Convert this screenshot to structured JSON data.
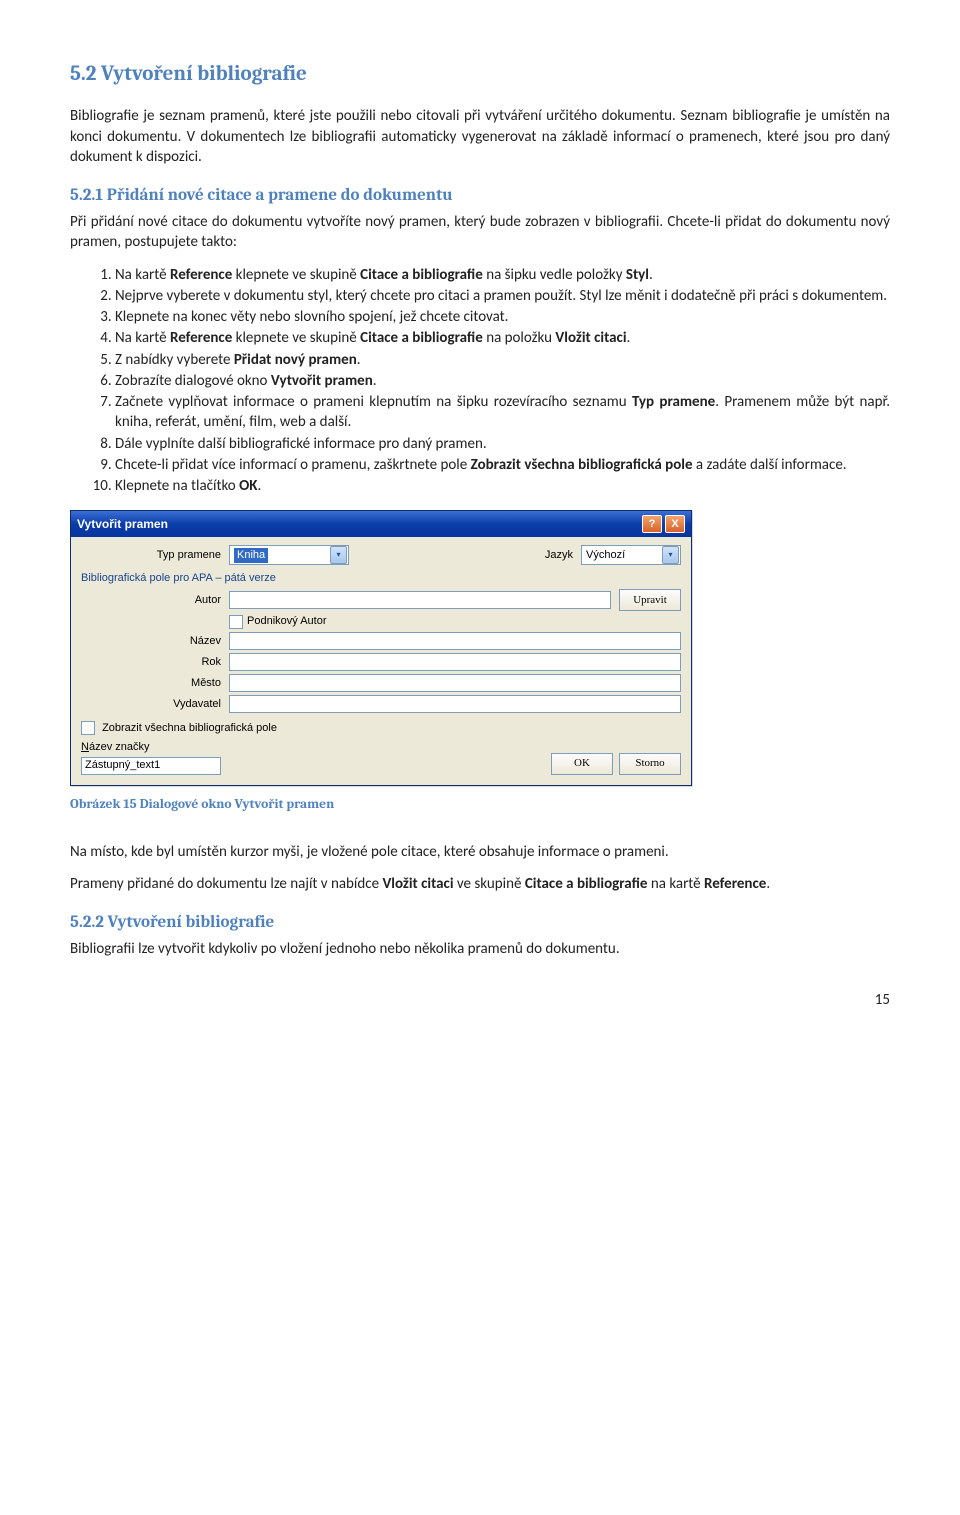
{
  "doc": {
    "h2": "5.2   Vytvoření bibliografie",
    "p1": "Bibliografie je seznam pramenů, které jste použili nebo citovali při vytváření určitého dokumentu. Seznam bibliografie je umístěn na konci dokumentu. V dokumentech lze bibliografii automaticky vygenerovat na základě informací o pramenech, které jsou pro daný dokument k dispozici.",
    "h3a": "5.2.1   Přidání nové citace a pramene do dokumentu",
    "p2": "Při přidání nové citace do dokumentu vytvoříte nový pramen, který bude zobrazen v bibliografii. Chcete-li přidat do dokumentu nový pramen, postupujete takto:",
    "ol": [
      {
        "pre": "Na kartě ",
        "b1": "Reference",
        "mid1": " klepnete ve skupině ",
        "b2": "Citace a bibliografie",
        "mid2": " na šipku vedle položky ",
        "b3": "Styl",
        "post": "."
      },
      {
        "text": "Nejprve vyberete v dokumentu styl, který chcete pro citaci a pramen použít. Styl lze měnit i dodatečně při práci s dokumentem."
      },
      {
        "text": "Klepnete na konec věty nebo slovního spojení, jež chcete citovat."
      },
      {
        "pre": "Na kartě ",
        "b1": "Reference",
        "mid1": " klepnete ve skupině ",
        "b2": "Citace a bibliografie",
        "mid2": " na položku ",
        "b3": "Vložit citaci",
        "post": "."
      },
      {
        "pre": "Z nabídky vyberete ",
        "b1": "Přidat nový pramen",
        "post": "."
      },
      {
        "pre": "Zobrazíte dialogové okno ",
        "b1": "Vytvořit pramen",
        "post": "."
      },
      {
        "pre": "Začnete vyplňovat informace o prameni klepnutím na šipku rozevíracího seznamu ",
        "b1": "Typ pramene",
        "post": ". Pramenem může být např. kniha, referát, umění, film, web a další."
      },
      {
        "text": "Dále vyplníte další bibliografické informace pro daný pramen."
      },
      {
        "pre": "Chcete-li přidat více informací o pramenu, zaškrtnete pole ",
        "b1": "Zobrazit všechna bibliografická pole",
        "post": " a zadáte další informace."
      },
      {
        "pre": "Klepnete na tlačítko ",
        "b1": "OK",
        "post": "."
      }
    ],
    "caption": "Obrázek 15 Dialogové okno Vytvořit pramen",
    "p3": "Na místo, kde byl umístěn kurzor myši, je vložené pole citace, které obsahuje informace o prameni.",
    "p4_pre": "Prameny přidané do dokumentu lze najít v nabídce ",
    "p4_b1": "Vložit citaci",
    "p4_mid": " ve skupině ",
    "p4_b2": "Citace a bibliografie",
    "p4_mid2": " na kartě ",
    "p4_b3": "Reference",
    "p4_post": ".",
    "h3b": "5.2.2   Vytvoření bibliografie",
    "p5": "Bibliografii lze vytvořit kdykoliv po vložení jednoho nebo několika pramenů do dokumentu.",
    "pagenum": "15"
  },
  "dlg": {
    "title": "Vytvořit pramen",
    "help": "?",
    "close": "X",
    "typ_label": "Typ pramene",
    "typ_value": "Kniha",
    "jazyk_label": "Jazyk",
    "jazyk_value": "Výchozí",
    "subhead": "Bibliografická pole pro APA – pátá verze",
    "autor_label": "Autor",
    "upravit": "Upravit",
    "pod_autor": "Podnikový Autor",
    "nazev_label": "Název",
    "rok_label": "Rok",
    "mesto_label": "Město",
    "vydavatel_label": "Vydavatel",
    "zobrazit_vse": "Zobrazit všechna bibliografická pole",
    "nazev_znacky": "Název značky",
    "zastupny": "Zástupný_text1",
    "ok": "OK",
    "storno": "Storno"
  }
}
